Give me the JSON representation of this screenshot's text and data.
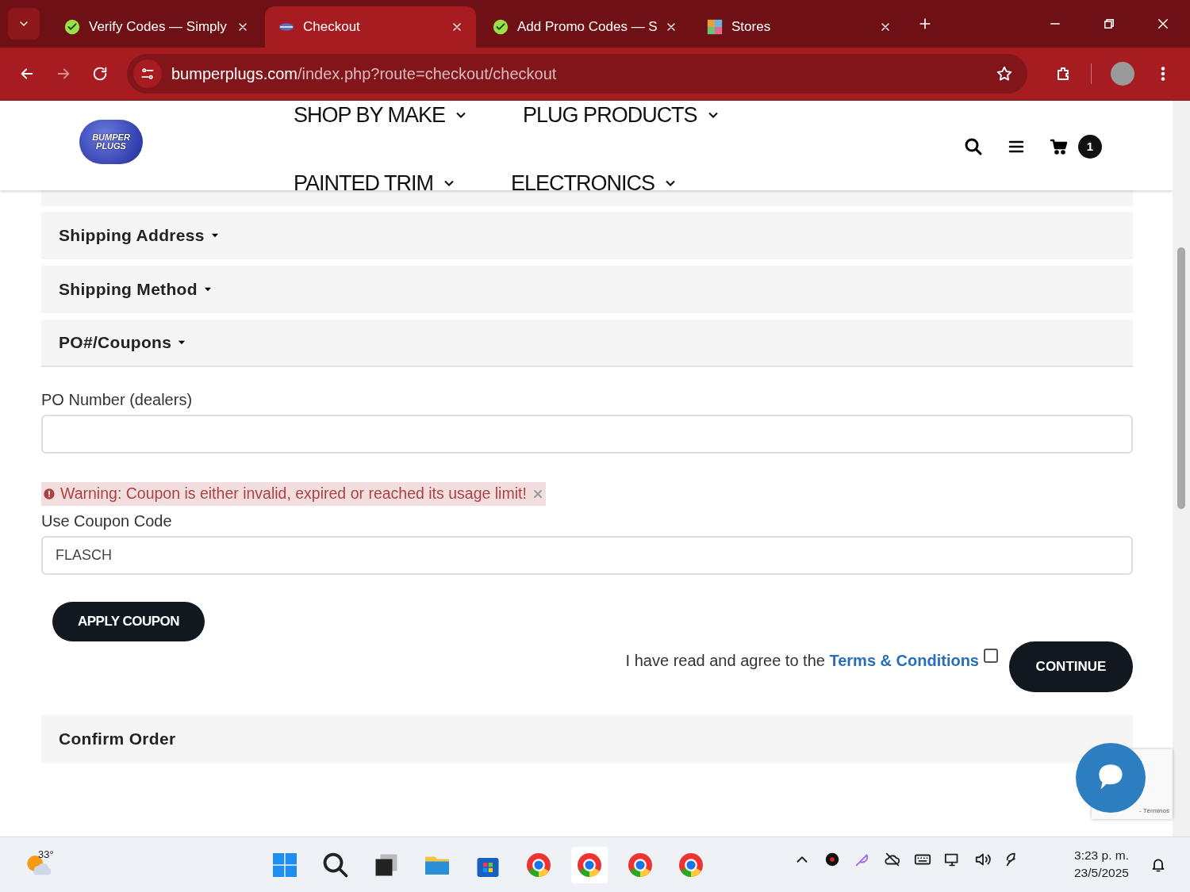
{
  "browser": {
    "tabs": [
      {
        "title": "Verify Codes — Simply",
        "kind": "check",
        "selected": false
      },
      {
        "title": "Checkout",
        "kind": "logo",
        "selected": true
      },
      {
        "title": "Add Promo Codes — S",
        "kind": "check",
        "selected": false
      },
      {
        "title": "Stores",
        "kind": "puzzle",
        "selected": false
      }
    ],
    "address": {
      "domain": "bumperplugs.com",
      "path": "/index.php?route=checkout/checkout"
    }
  },
  "site_header": {
    "logo_text": "BUMPER PLUGS",
    "nav": [
      {
        "label": "SHOP BY MAKE"
      },
      {
        "label": "PLUG PRODUCTS"
      },
      {
        "label": "PAINTED TRIM"
      },
      {
        "label": "ELECTRONICS"
      }
    ],
    "cart_count": "1"
  },
  "checkout": {
    "sections": [
      {
        "title": "Shipping Address",
        "expanded": false
      },
      {
        "title": "Shipping Method",
        "expanded": false
      },
      {
        "title": "PO#/Coupons",
        "expanded": true
      }
    ],
    "po_label": "PO Number (dealers)",
    "warning": "Warning: Coupon is either invalid, expired or reached its usage limit!",
    "coupon_label": "Use Coupon Code",
    "coupon_value": "FLASCH",
    "apply_button": "APPLY COUPON",
    "terms": {
      "prefix": "I have read and agree to the",
      "link": "Terms & Conditions",
      "checked": false
    },
    "continue_button": "CONTINUE",
    "confirm_section": "Confirm Order"
  },
  "recaptcha_text": "- Términos",
  "taskbar": {
    "weather": "33°",
    "time": "3:23 p. m.",
    "date": "23/5/2025"
  }
}
